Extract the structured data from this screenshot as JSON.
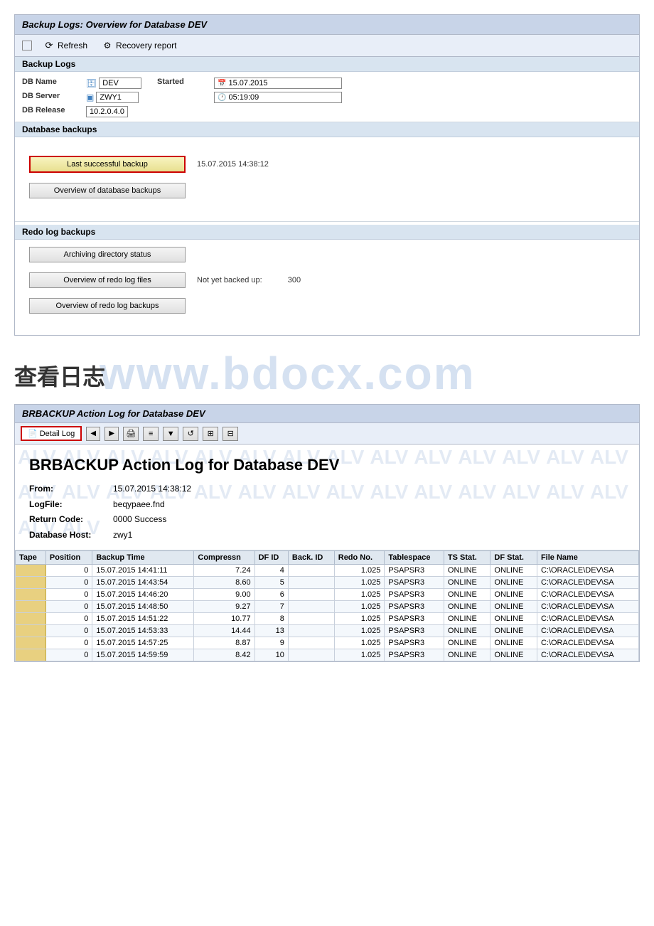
{
  "topPanel": {
    "title": "Backup Logs: Overview for Database DEV",
    "toolbar": {
      "refreshLabel": "Refresh",
      "recoveryLabel": "Recovery report"
    },
    "backupLogs": {
      "sectionLabel": "Backup Logs",
      "dbNameLabel": "DB Name",
      "dbNameValue": "DEV",
      "startedLabel": "Started",
      "dateValue": "15.07.2015",
      "dbServerLabel": "DB Server",
      "dbServerValue": "ZWY1",
      "timeValue": "05:19:09",
      "dbReleaseLabel": "DB Release",
      "dbReleaseValue": "10.2.0.4.0"
    },
    "databaseBackups": {
      "sectionLabel": "Database backups",
      "lastSuccessfulBtn": "Last successful backup",
      "lastSuccessfulDate": "15.07.2015 14:38:12",
      "overviewBtn": "Overview of database backups"
    },
    "redoLogBackups": {
      "sectionLabel": "Redo log backups",
      "archivingBtn": "Archiving directory status",
      "overviewRedoBtn": "Overview of redo log files",
      "notYetLabel": "Not yet backed up:",
      "notYetValue": "300",
      "overviewRedoBackupsBtn": "Overview of redo log backups"
    }
  },
  "middleSection": {
    "chineseText": "查看日志",
    "watermarkText": "www.bdocx.com"
  },
  "bottomPanel": {
    "title": "BRBACKUP Action Log for Database DEV",
    "toolbar": {
      "detailLogLabel": "Detail Log",
      "icons": [
        "◀",
        "▶",
        "🖨",
        "≡",
        "▼",
        "↺",
        "⊞",
        "⊟"
      ]
    },
    "logContent": {
      "title": "BRBACKUP Action Log for Database DEV",
      "fromLabel": "From:",
      "fromValue": "15.07.2015 14:38:12",
      "logFileLabel": "LogFile:",
      "logFileValue": "beqypaee.fnd",
      "returnCodeLabel": "Return Code:",
      "returnCodeValue": "0000 Success",
      "dbHostLabel": "Database Host:",
      "dbHostValue": "zwy1"
    },
    "table": {
      "columns": [
        "Tape",
        "Position",
        "Backup Time",
        "Compressn",
        "DF ID",
        "Back. ID",
        "Redo No.",
        "Tablespace",
        "TS Stat.",
        "DF Stat.",
        "File Name"
      ],
      "rows": [
        {
          "tape": "",
          "position": "0",
          "backupTime": "15.07.2015 14:41:11",
          "compress": "7.24",
          "dfId": "4",
          "backId": "",
          "redoNo": "1.025",
          "tablespace": "PSAPSR3",
          "tsStat": "ONLINE",
          "dfStat": "ONLINE",
          "fileName": "C:\\ORACLE\\DEV\\SA"
        },
        {
          "tape": "",
          "position": "0",
          "backupTime": "15.07.2015 14:43:54",
          "compress": "8.60",
          "dfId": "5",
          "backId": "",
          "redoNo": "1.025",
          "tablespace": "PSAPSR3",
          "tsStat": "ONLINE",
          "dfStat": "ONLINE",
          "fileName": "C:\\ORACLE\\DEV\\SA"
        },
        {
          "tape": "",
          "position": "0",
          "backupTime": "15.07.2015 14:46:20",
          "compress": "9.00",
          "dfId": "6",
          "backId": "",
          "redoNo": "1.025",
          "tablespace": "PSAPSR3",
          "tsStat": "ONLINE",
          "dfStat": "ONLINE",
          "fileName": "C:\\ORACLE\\DEV\\SA"
        },
        {
          "tape": "",
          "position": "0",
          "backupTime": "15.07.2015 14:48:50",
          "compress": "9.27",
          "dfId": "7",
          "backId": "",
          "redoNo": "1.025",
          "tablespace": "PSAPSR3",
          "tsStat": "ONLINE",
          "dfStat": "ONLINE",
          "fileName": "C:\\ORACLE\\DEV\\SA"
        },
        {
          "tape": "",
          "position": "0",
          "backupTime": "15.07.2015 14:51:22",
          "compress": "10.77",
          "dfId": "8",
          "backId": "",
          "redoNo": "1.025",
          "tablespace": "PSAPSR3",
          "tsStat": "ONLINE",
          "dfStat": "ONLINE",
          "fileName": "C:\\ORACLE\\DEV\\SA"
        },
        {
          "tape": "",
          "position": "0",
          "backupTime": "15.07.2015 14:53:33",
          "compress": "14.44",
          "dfId": "13",
          "backId": "",
          "redoNo": "1.025",
          "tablespace": "PSAPSR3",
          "tsStat": "ONLINE",
          "dfStat": "ONLINE",
          "fileName": "C:\\ORACLE\\DEV\\SA"
        },
        {
          "tape": "",
          "position": "0",
          "backupTime": "15.07.2015 14:57:25",
          "compress": "8.87",
          "dfId": "9",
          "backId": "",
          "redoNo": "1.025",
          "tablespace": "PSAPSR3",
          "tsStat": "ONLINE",
          "dfStat": "ONLINE",
          "fileName": "C:\\ORACLE\\DEV\\SA"
        },
        {
          "tape": "",
          "position": "0",
          "backupTime": "15.07.2015 14:59:59",
          "compress": "8.42",
          "dfId": "10",
          "backId": "",
          "redoNo": "1.025",
          "tablespace": "PSAPSR3",
          "tsStat": "ONLINE",
          "dfStat": "ONLINE",
          "fileName": "C:\\ORACLE\\DEV\\SA"
        }
      ]
    }
  }
}
